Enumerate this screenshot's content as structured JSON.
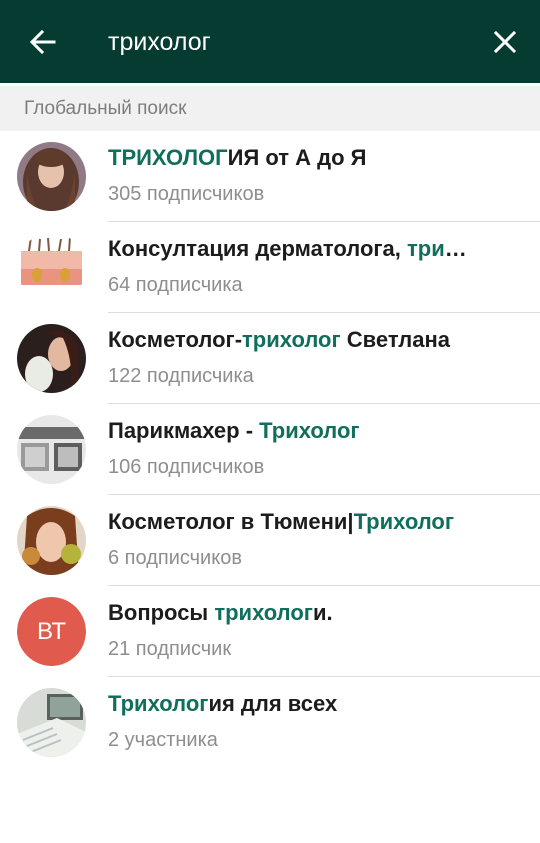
{
  "search": {
    "query": "трихолог"
  },
  "section": {
    "title": "Глобальный поиск"
  },
  "results": [
    {
      "pre": "",
      "hl": "ТРИХОЛОГ",
      "post": "ИЯ от А до Я",
      "subtitle": "305 подписчиков"
    },
    {
      "pre": "Консултация дерматолога, ",
      "hl": "три",
      "post": "…",
      "subtitle": "64 подписчика"
    },
    {
      "pre": "Косметолог-",
      "hl": "трихолог",
      "post": " Светлана",
      "subtitle": "122 подписчика"
    },
    {
      "pre": "Парикмахер - ",
      "hl": "Трихолог",
      "post": "",
      "subtitle": "106 подписчиков"
    },
    {
      "pre": "Косметолог в Тюмени|",
      "hl": "Трихолог",
      "post": "",
      "subtitle": "6 подписчиков"
    },
    {
      "pre": "Вопросы ",
      "hl": "трихолог",
      "post": "и.",
      "subtitle": "21 подписчик",
      "initials": "ВТ"
    },
    {
      "pre": "",
      "hl": "Трихолог",
      "post": "ия для всех",
      "subtitle": "2 участника"
    }
  ],
  "colors": {
    "appbar": "#063b32",
    "highlight": "#0f6e5c",
    "initials_avatar": "#e15a4e"
  },
  "icons": {
    "back": "arrow-left-icon",
    "close": "close-icon"
  }
}
